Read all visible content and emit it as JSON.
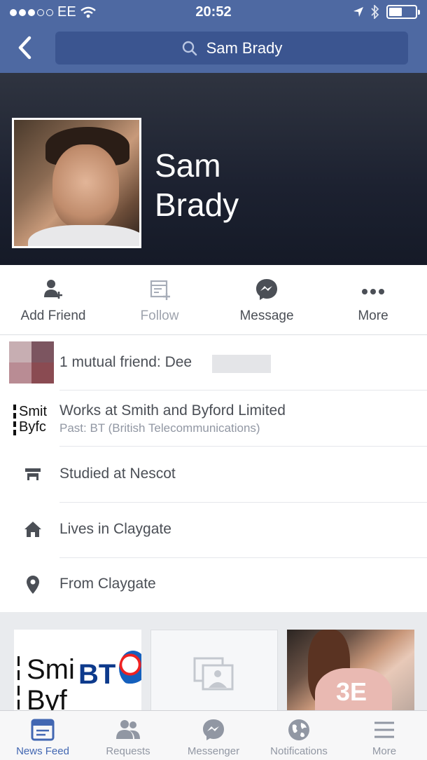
{
  "status_bar": {
    "carrier": "EE",
    "time": "20:52"
  },
  "nav": {
    "search_value": "Sam Brady"
  },
  "profile": {
    "first_name": "Sam",
    "last_name": "Brady"
  },
  "actions": [
    {
      "label": "Add Friend",
      "icon": "add-friend-icon",
      "enabled": true
    },
    {
      "label": "Follow",
      "icon": "follow-icon",
      "enabled": false
    },
    {
      "label": "Message",
      "icon": "messenger-icon",
      "enabled": true
    },
    {
      "label": "More",
      "icon": "more-dots-icon",
      "enabled": true
    }
  ],
  "mutual": {
    "text": "1 mutual friend: Dee"
  },
  "work": {
    "logo_line1": "Smit",
    "logo_line2": "Byfc",
    "text": "Works at Smith and Byford Limited",
    "past": "Past: BT (British Telecommunications)"
  },
  "education": {
    "text": "Studied at Nescot",
    "icon": "education-icon"
  },
  "lives": {
    "text": "Lives in Claygate",
    "icon": "home-icon"
  },
  "from": {
    "text": "From Claygate",
    "icon": "location-pin-icon"
  },
  "photos": {
    "tile1_text_a": "Smi",
    "tile1_text_b": "Byf",
    "tile1_bt": "BT",
    "tile3_text": "3E"
  },
  "tabs": [
    {
      "label": "News Feed",
      "icon": "news-feed-icon",
      "active": true
    },
    {
      "label": "Requests",
      "icon": "requests-icon",
      "active": false
    },
    {
      "label": "Messenger",
      "icon": "messenger-icon",
      "active": false
    },
    {
      "label": "Notifications",
      "icon": "globe-icon",
      "active": false
    },
    {
      "label": "More",
      "icon": "menu-icon",
      "active": false
    }
  ],
  "colors": {
    "brand_blue": "#4e69a2",
    "active_tab": "#4267b2",
    "icon_gray": "#4b4f56"
  }
}
